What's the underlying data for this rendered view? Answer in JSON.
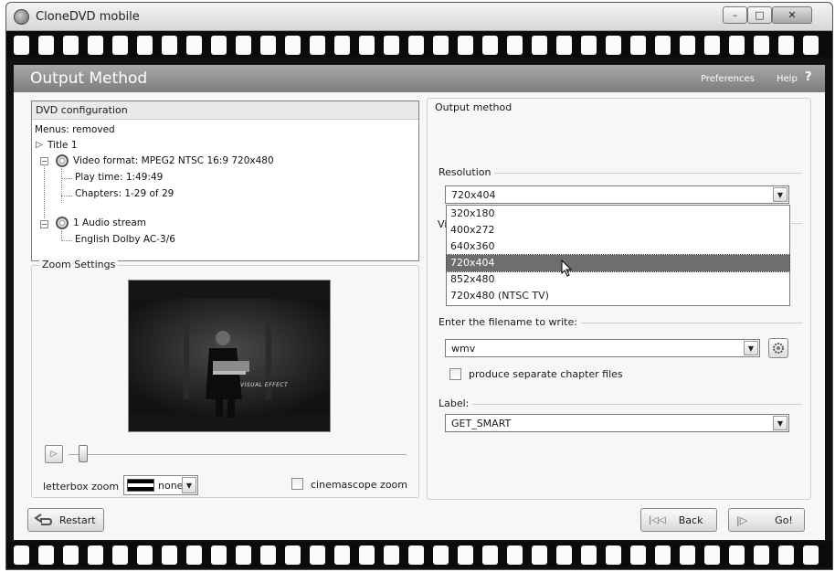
{
  "window": {
    "title": "CloneDVD mobile",
    "close_glyph": "✕",
    "max_glyph": "□",
    "min_glyph": "–"
  },
  "header": {
    "title": "Output Method",
    "preferences": "Preferences",
    "help": "Help",
    "help_q": "?"
  },
  "dvd_config": {
    "header": "DVD configuration",
    "menus": "Menus: removed",
    "title": "Title 1",
    "video_format": "Video format: MPEG2 NTSC 16:9 720x480",
    "play_time": "Play time: 1:49:49",
    "chapters": "Chapters: 1-29 of 29",
    "audio_streams": "1 Audio stream",
    "audio_track": "English Dolby AC-3/6"
  },
  "zoom": {
    "label": "Zoom Settings",
    "preview_caption": "VISUAL EFFECT",
    "letterbox_label": "letterbox zoom",
    "letterbox_value": "none",
    "cinemascope_label": "cinemascope zoom",
    "cinemascope_checked": false
  },
  "output": {
    "label": "Output method",
    "resolution_label": "Resolution",
    "resolution_value": "720x404",
    "resolution_options": [
      "320x180",
      "400x272",
      "640x360",
      "720x404",
      "852x480",
      "720x480 (NTSC TV)"
    ],
    "hidden_label_fragment": "Vi",
    "filename_label": "Enter the filename to write:",
    "filename_value": "wmv",
    "separate_chapters_label": "produce separate chapter files",
    "separate_chapters_checked": false,
    "label_label": "Label:",
    "label_value": "GET_SMART"
  },
  "nav": {
    "restart": "Restart",
    "back": "Back",
    "go": "Go!"
  },
  "colors": {
    "header_bg": "#8c8c8c",
    "selected_option": "#6e6e6e",
    "film": "#0b0b0b"
  }
}
